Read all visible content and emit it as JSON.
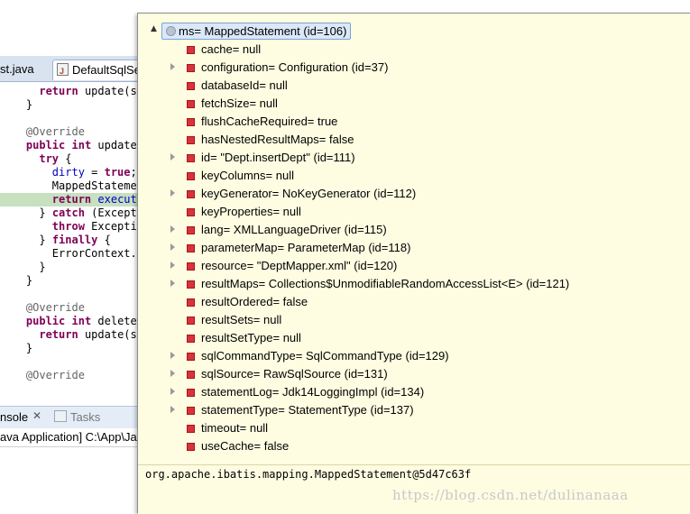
{
  "editor": {
    "tabs": [
      {
        "label": "st.java"
      },
      {
        "label": "DefaultSqlSe"
      }
    ],
    "code_lines": [
      {
        "pre": "    ",
        "parts": [
          {
            "t": "return",
            "c": "kw"
          },
          {
            "t": " update(sta",
            "c": ""
          }
        ]
      },
      {
        "pre": "  ",
        "parts": [
          {
            "t": "}",
            "c": ""
          }
        ]
      },
      {
        "pre": "",
        "parts": []
      },
      {
        "pre": "  ",
        "parts": [
          {
            "t": "@Override",
            "c": "ann"
          }
        ]
      },
      {
        "pre": "  ",
        "parts": [
          {
            "t": "public",
            "c": "kw"
          },
          {
            "t": " ",
            "c": ""
          },
          {
            "t": "int",
            "c": "kw"
          },
          {
            "t": " update(S",
            "c": ""
          }
        ]
      },
      {
        "pre": "    ",
        "parts": [
          {
            "t": "try",
            "c": "kw"
          },
          {
            "t": " {",
            "c": ""
          }
        ]
      },
      {
        "pre": "      ",
        "parts": [
          {
            "t": "dirty",
            "c": "fld"
          },
          {
            "t": " = ",
            "c": ""
          },
          {
            "t": "true",
            "c": "kw"
          },
          {
            "t": ";",
            "c": ""
          }
        ]
      },
      {
        "pre": "      ",
        "parts": [
          {
            "t": "MappedStatement",
            "c": ""
          }
        ]
      },
      {
        "pre": "      ",
        "parts": [
          {
            "t": "return",
            "c": "kw"
          },
          {
            "t": " ",
            "c": ""
          },
          {
            "t": "executor",
            "c": "fld"
          }
        ],
        "highlight": true
      },
      {
        "pre": "    ",
        "parts": [
          {
            "t": "} ",
            "c": ""
          },
          {
            "t": "catch",
            "c": "kw"
          },
          {
            "t": " (Exception",
            "c": ""
          }
        ]
      },
      {
        "pre": "      ",
        "parts": [
          {
            "t": "throw",
            "c": "kw"
          },
          {
            "t": " Exception",
            "c": ""
          }
        ]
      },
      {
        "pre": "    ",
        "parts": [
          {
            "t": "} ",
            "c": ""
          },
          {
            "t": "finally",
            "c": "kw"
          },
          {
            "t": " {",
            "c": ""
          }
        ]
      },
      {
        "pre": "      ",
        "parts": [
          {
            "t": "ErrorContext.in",
            "c": ""
          }
        ]
      },
      {
        "pre": "    ",
        "parts": [
          {
            "t": "}",
            "c": ""
          }
        ]
      },
      {
        "pre": "  ",
        "parts": [
          {
            "t": "}",
            "c": ""
          }
        ]
      },
      {
        "pre": "",
        "parts": []
      },
      {
        "pre": "  ",
        "parts": [
          {
            "t": "@Override",
            "c": "ann"
          }
        ]
      },
      {
        "pre": "  ",
        "parts": [
          {
            "t": "public",
            "c": "kw"
          },
          {
            "t": " ",
            "c": ""
          },
          {
            "t": "int",
            "c": "kw"
          },
          {
            "t": " delete(S",
            "c": ""
          }
        ]
      },
      {
        "pre": "    ",
        "parts": [
          {
            "t": "return",
            "c": "kw"
          },
          {
            "t": " update(sta",
            "c": ""
          }
        ]
      },
      {
        "pre": "  ",
        "parts": [
          {
            "t": "}",
            "c": ""
          }
        ]
      },
      {
        "pre": "",
        "parts": []
      },
      {
        "pre": "  ",
        "parts": [
          {
            "t": "@Override",
            "c": "ann"
          }
        ]
      }
    ],
    "console": {
      "tab_label": "nsole",
      "close_glyph": "✕",
      "tasks_label": "Tasks",
      "info": "ava Application] C:\\App\\Jav"
    }
  },
  "inspector": {
    "root_label": "ms= MappedStatement  (id=106)",
    "rows": [
      {
        "label": "cache= null",
        "expandable": false
      },
      {
        "label": "configuration= Configuration  (id=37)",
        "expandable": true
      },
      {
        "label": "databaseId= null",
        "expandable": false
      },
      {
        "label": "fetchSize= null",
        "expandable": false
      },
      {
        "label": "flushCacheRequired= true",
        "expandable": false
      },
      {
        "label": "hasNestedResultMaps= false",
        "expandable": false
      },
      {
        "label": "id= \"Dept.insertDept\" (id=111)",
        "expandable": true
      },
      {
        "label": "keyColumns= null",
        "expandable": false
      },
      {
        "label": "keyGenerator= NoKeyGenerator  (id=112)",
        "expandable": true
      },
      {
        "label": "keyProperties= null",
        "expandable": false
      },
      {
        "label": "lang= XMLLanguageDriver  (id=115)",
        "expandable": true
      },
      {
        "label": "parameterMap= ParameterMap  (id=118)",
        "expandable": true
      },
      {
        "label": "resource= \"DeptMapper.xml\" (id=120)",
        "expandable": true
      },
      {
        "label": "resultMaps= Collections$UnmodifiableRandomAccessList<E>  (id=121)",
        "expandable": true
      },
      {
        "label": "resultOrdered= false",
        "expandable": false
      },
      {
        "label": "resultSets= null",
        "expandable": false
      },
      {
        "label": "resultSetType= null",
        "expandable": false
      },
      {
        "label": "sqlCommandType= SqlCommandType  (id=129)",
        "expandable": true
      },
      {
        "label": "sqlSource= RawSqlSource  (id=131)",
        "expandable": true
      },
      {
        "label": "statementLog= Jdk14LoggingImpl  (id=134)",
        "expandable": true
      },
      {
        "label": "statementType= StatementType  (id=137)",
        "expandable": true
      },
      {
        "label": "timeout= null",
        "expandable": false
      },
      {
        "label": "useCache= false",
        "expandable": false
      }
    ],
    "detail_text": "org.apache.ibatis.mapping.MappedStatement@5d47c63f",
    "watermark": "https://blog.csdn.net/dulinanaaa"
  },
  "icons": {
    "root_collapse": "chevron-up-icon",
    "field": "private-field-icon",
    "expand": "expand-arrow-icon"
  },
  "colors": {
    "popup_background": "#fefde2",
    "field_icon": "#d8323a",
    "root_highlight": "#dbe8fa",
    "code_highlight": "#c6e0c0"
  }
}
